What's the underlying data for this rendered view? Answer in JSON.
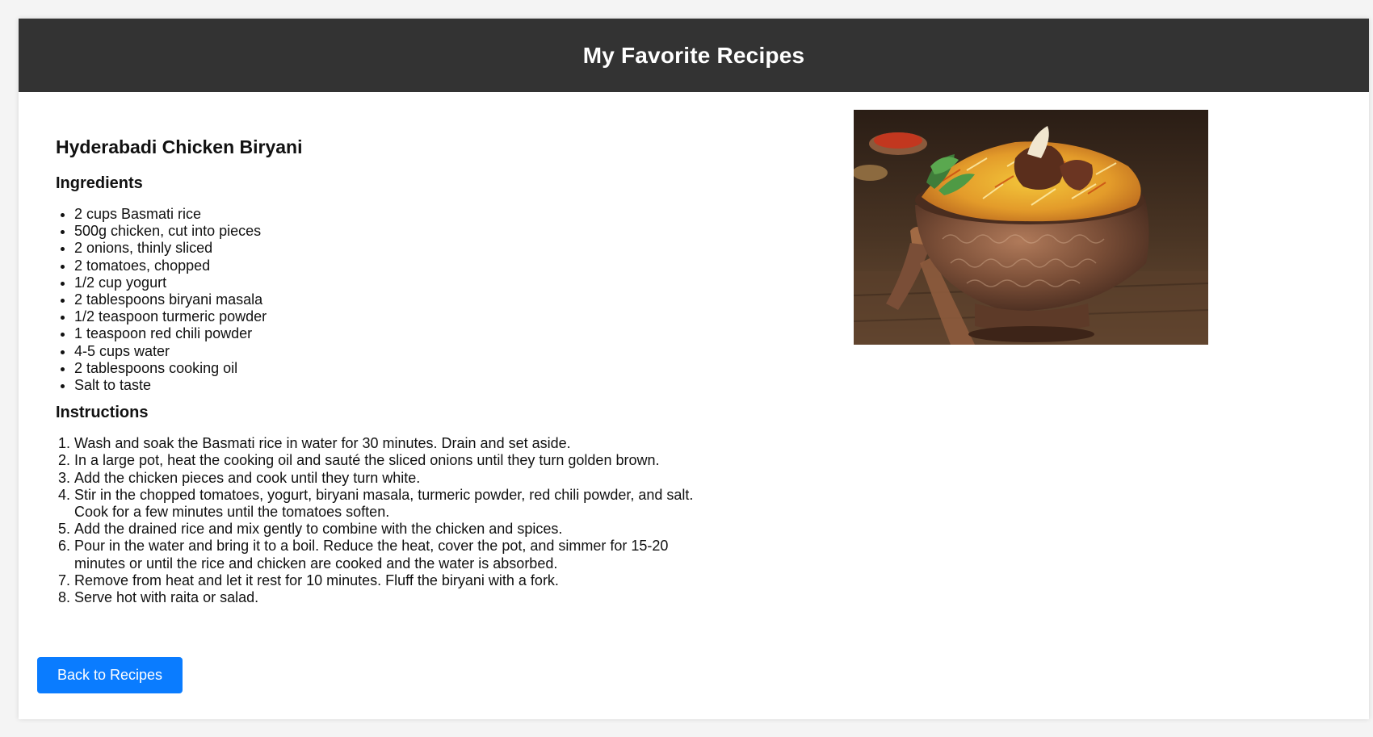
{
  "header": {
    "title": "My Favorite Recipes"
  },
  "recipe": {
    "title": "Hyderabadi Chicken Biryani",
    "ingredients_heading": "Ingredients",
    "ingredients": [
      "2 cups Basmati rice",
      "500g chicken, cut into pieces",
      "2 onions, thinly sliced",
      "2 tomatoes, chopped",
      "1/2 cup yogurt",
      "2 tablespoons biryani masala",
      "1/2 teaspoon turmeric powder",
      "1 teaspoon red chili powder",
      "4-5 cups water",
      "2 tablespoons cooking oil",
      "Salt to taste"
    ],
    "instructions_heading": "Instructions",
    "instructions": [
      "Wash and soak the Basmati rice in water for 30 minutes. Drain and set aside.",
      "In a large pot, heat the cooking oil and sauté the sliced onions until they turn golden brown.",
      "Add the chicken pieces and cook until they turn white.",
      "Stir in the chopped tomatoes, yogurt, biryani masala, turmeric powder, red chili powder, and salt. Cook for a few minutes until the tomatoes soften.",
      "Add the drained rice and mix gently to combine with the chicken and spices.",
      "Pour in the water and bring it to a boil. Reduce the heat, cover the pot, and simmer for 15-20 minutes or until the rice and chicken are cooked and the water is absorbed.",
      "Remove from heat and let it rest for 10 minutes. Fluff the biryani with a fork.",
      "Serve hot with raita or salad."
    ]
  },
  "actions": {
    "back_label": "Back to Recipes"
  },
  "colors": {
    "header_bg": "#333333",
    "button_bg": "#0a7cff",
    "page_bg": "#f4f4f4"
  }
}
